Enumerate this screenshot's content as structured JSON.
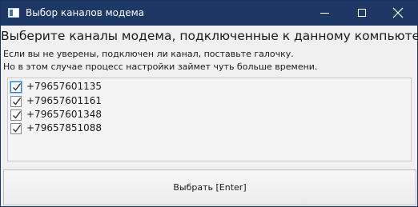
{
  "window": {
    "title": "Выбор каналов модема"
  },
  "header": {
    "text": "Выберите каналы модема, подключенные к данному компьютеру"
  },
  "hints": [
    "Если вы не уверены, подключен ли канал, поставьте галочку.",
    "Но в этом случае процесс настройки займет чуть больше времени."
  ],
  "channels": [
    {
      "label": "+79657601135",
      "checked": true
    },
    {
      "label": "+79657601161",
      "checked": true
    },
    {
      "label": "+79657601348",
      "checked": true
    },
    {
      "label": "+79657851088",
      "checked": true
    }
  ],
  "select_button": {
    "label": "Выбрать [Enter]"
  }
}
